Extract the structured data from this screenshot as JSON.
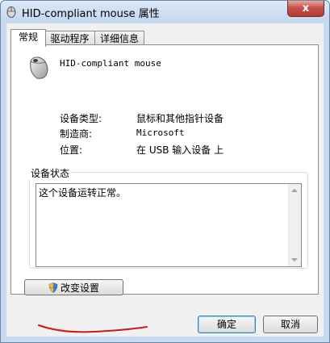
{
  "window": {
    "title": "HID-compliant mouse 属性",
    "close_symbol": "x"
  },
  "tabs": [
    {
      "label": "常规",
      "active": true
    },
    {
      "label": "驱动程序",
      "active": false
    },
    {
      "label": "详细信息",
      "active": false
    }
  ],
  "device": {
    "name": "HID-compliant mouse",
    "icon": "mouse-icon"
  },
  "properties": [
    {
      "label": "设备类型:",
      "value": "鼠标和其他指针设备"
    },
    {
      "label": "制造商:",
      "value": "Microsoft"
    },
    {
      "label": "位置:",
      "value": "在 USB 输入设备 上"
    }
  ],
  "status": {
    "group_label": "设备状态",
    "text": "这个设备运转正常。"
  },
  "buttons": {
    "change_settings": "改变设置",
    "ok": "确定",
    "cancel": "取消"
  },
  "colors": {
    "accent_border": "#3c7fb1",
    "close_button": "#c75050",
    "annotation_red": "#cc1a1a"
  }
}
